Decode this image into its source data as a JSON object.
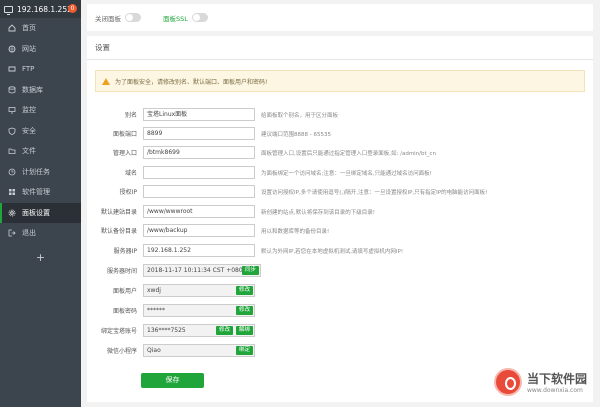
{
  "sidebar": {
    "ip": "192.168.1.252",
    "badge": "0",
    "items": [
      {
        "label": "首页",
        "icon": "home-icon"
      },
      {
        "label": "网站",
        "icon": "globe-icon"
      },
      {
        "label": "FTP",
        "icon": "ftp-icon"
      },
      {
        "label": "数据库",
        "icon": "database-icon"
      },
      {
        "label": "监控",
        "icon": "monitor-icon"
      },
      {
        "label": "安全",
        "icon": "shield-icon"
      },
      {
        "label": "文件",
        "icon": "folder-icon"
      },
      {
        "label": "计划任务",
        "icon": "clock-icon"
      },
      {
        "label": "软件管理",
        "icon": "apps-icon"
      },
      {
        "label": "面板设置",
        "icon": "gear-icon"
      },
      {
        "label": "退出",
        "icon": "exit-icon"
      }
    ],
    "active_index": 9,
    "add_label": "+"
  },
  "topbar": {
    "close_panel_label": "关闭面板",
    "panel_ssl_label": "面板SSL"
  },
  "panel": {
    "title": "设置",
    "alert": "为了面板安全，请修改别名、默认端口、面板用户和密码!",
    "rows": [
      {
        "label": "别名",
        "value": "宝塔Linux面板",
        "hint": "给面板取个别名，用于区分面板"
      },
      {
        "label": "面板端口",
        "value": "8899",
        "hint": "建议端口范围8888 - 65535"
      },
      {
        "label": "管理入口",
        "value": "/btmk8699",
        "hint": "面板管理入口,设置后只能通过指定管理入口登录面板,如: /admin/bt_cn"
      },
      {
        "label": "域名",
        "value": "",
        "hint": "为面板绑定一个访问域名;注意：一旦绑定域名,只能通过域名访问面板!"
      },
      {
        "label": "授权IP",
        "value": "",
        "hint": "设置访问授权IP,多个请使用逗号(,)隔开,注意：一旦设置授权IP,只有指定IP的电脑能访问面板!"
      },
      {
        "label": "默认建站目录",
        "value": "/www/wwwroot",
        "hint": "新创建的站点,默认将保存到该目录的下级目录!"
      },
      {
        "label": "默认备份目录",
        "value": "/www/backup",
        "hint": "用以和数据库等的备份目录!"
      },
      {
        "label": "服务器IP",
        "value": "192.168.1.252",
        "hint": "默认为外网IP,若您在本地虚拟机测试,请填写虚拟机内网IP!"
      },
      {
        "label": "服务器时间",
        "value": "2018-11-17 10:11:34 CST +0800",
        "hint": "",
        "buttons": [
          "同步"
        ]
      },
      {
        "label": "面板用户",
        "value": "xwdj",
        "hint": "",
        "buttons": [
          "修改"
        ]
      },
      {
        "label": "面板密码",
        "value": "******",
        "hint": "",
        "buttons": [
          "修改"
        ]
      },
      {
        "label": "绑定宝塔账号",
        "value": "136****7525",
        "hint": "",
        "buttons": [
          "修改",
          "解绑"
        ]
      },
      {
        "label": "微信小程序",
        "value": "Qiao",
        "hint": "",
        "buttons": [
          "绑定"
        ]
      }
    ],
    "save_label": "保存"
  },
  "watermark": {
    "title": "当下软件园",
    "url": "www.downxia.com"
  },
  "colors": {
    "accent": "#20a53a",
    "sidebar_bg": "#3c444d",
    "badge": "#f0592b"
  }
}
